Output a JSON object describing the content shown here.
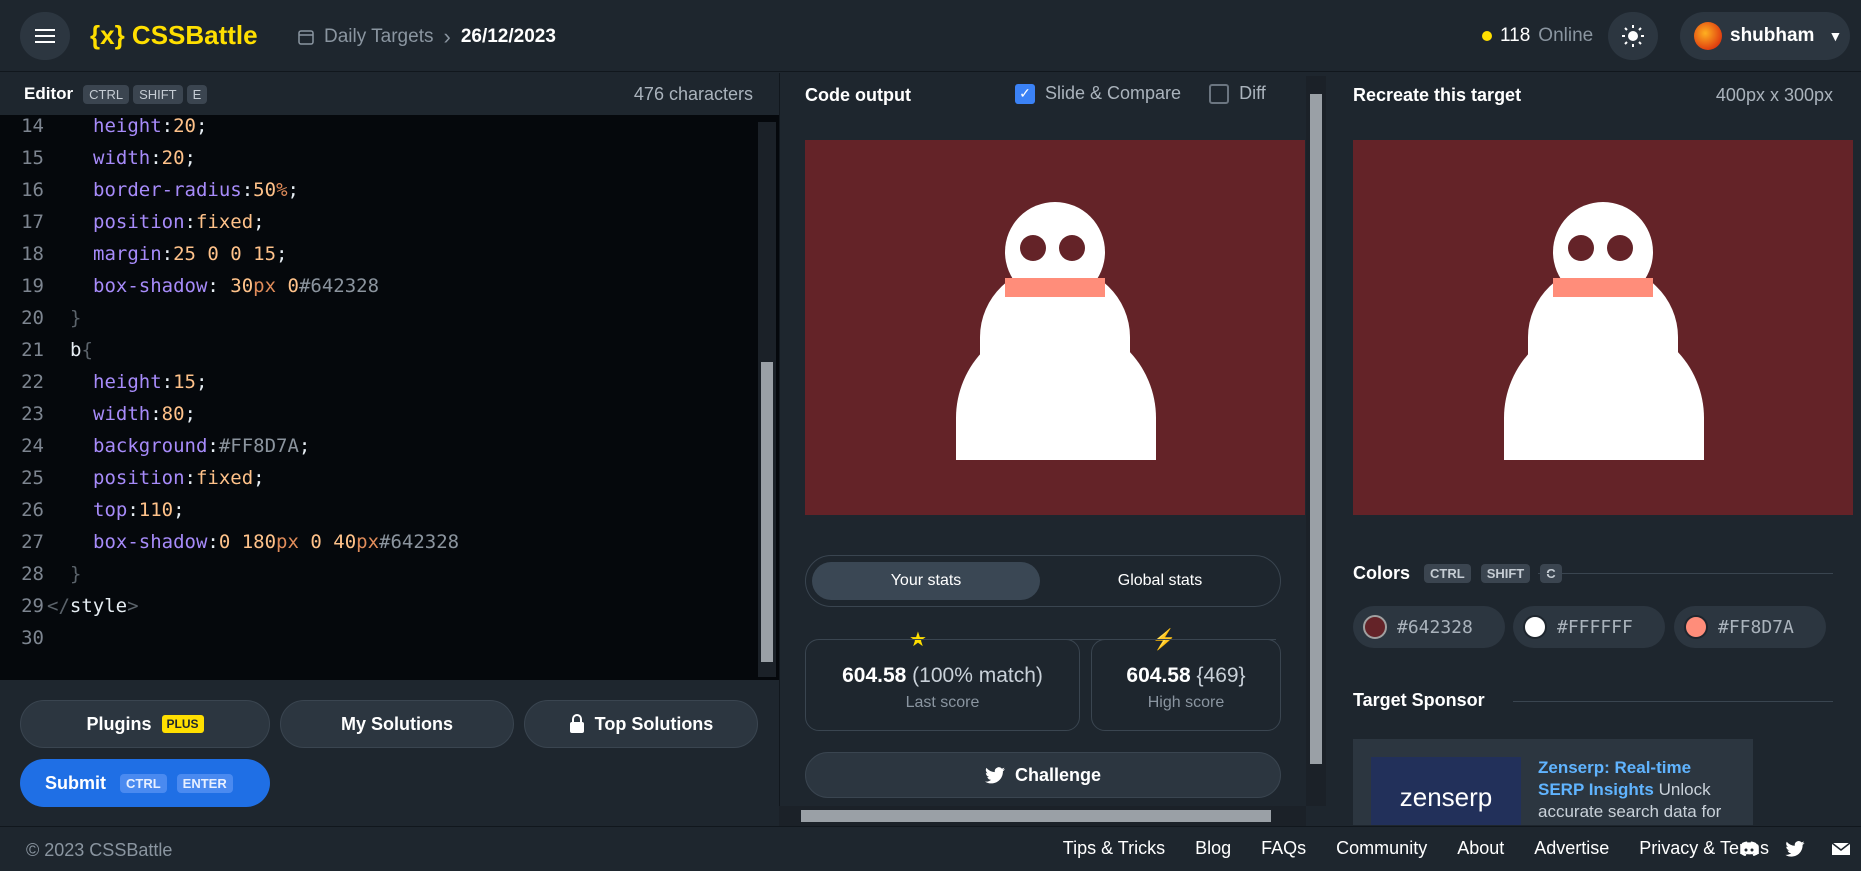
{
  "header": {
    "logo": "{x} CSSBattle",
    "breadcrumb_parent": "Daily Targets",
    "breadcrumb_date": "26/12/2023",
    "online_count": "118",
    "online_label": "Online",
    "username": "shubham"
  },
  "editor": {
    "title": "Editor",
    "shortcut": [
      "CTRL",
      "SHIFT",
      "E"
    ],
    "char_count": "476 characters",
    "lines": [
      {
        "n": "14",
        "parts": [
          [
            "p",
            "height"
          ],
          [
            "w",
            ":"
          ],
          [
            "v",
            "20"
          ],
          [
            "w",
            ";"
          ]
        ],
        "indent": 2
      },
      {
        "n": "15",
        "parts": [
          [
            "p",
            "width"
          ],
          [
            "w",
            ":"
          ],
          [
            "v",
            "20"
          ],
          [
            "w",
            ";"
          ]
        ],
        "indent": 2
      },
      {
        "n": "16",
        "parts": [
          [
            "p",
            "border-radius"
          ],
          [
            "w",
            ":"
          ],
          [
            "v",
            "50"
          ],
          [
            "u",
            "%"
          ],
          [
            "w",
            ";"
          ]
        ],
        "indent": 2
      },
      {
        "n": "17",
        "parts": [
          [
            "p",
            "position"
          ],
          [
            "w",
            ":"
          ],
          [
            "v",
            "fixed"
          ],
          [
            "w",
            ";"
          ]
        ],
        "indent": 2
      },
      {
        "n": "18",
        "parts": [
          [
            "p",
            "margin"
          ],
          [
            "w",
            ":"
          ],
          [
            "v",
            "25 0 0 15"
          ],
          [
            "w",
            ";"
          ]
        ],
        "indent": 2
      },
      {
        "n": "19",
        "parts": [
          [
            "p",
            "box-shadow"
          ],
          [
            "w",
            ": "
          ],
          [
            "v",
            "30"
          ],
          [
            "u",
            "px"
          ],
          [
            "v",
            " 0"
          ],
          [
            "c",
            "#642328"
          ]
        ],
        "indent": 2
      },
      {
        "n": "20",
        "parts": [
          [
            "dim",
            "}"
          ]
        ],
        "indent": 1
      },
      {
        "n": "21",
        "parts": [
          [
            "w",
            "b"
          ],
          [
            "dim",
            "{"
          ]
        ],
        "indent": 1
      },
      {
        "n": "22",
        "parts": [
          [
            "p",
            "height"
          ],
          [
            "w",
            ":"
          ],
          [
            "v",
            "15"
          ],
          [
            "w",
            ";"
          ]
        ],
        "indent": 2
      },
      {
        "n": "23",
        "parts": [
          [
            "p",
            "width"
          ],
          [
            "w",
            ":"
          ],
          [
            "v",
            "80"
          ],
          [
            "w",
            ";"
          ]
        ],
        "indent": 2
      },
      {
        "n": "24",
        "parts": [
          [
            "p",
            "background"
          ],
          [
            "w",
            ":"
          ],
          [
            "c",
            "#FF8D7A"
          ],
          [
            "w",
            ";"
          ]
        ],
        "indent": 2
      },
      {
        "n": "25",
        "parts": [
          [
            "p",
            "position"
          ],
          [
            "w",
            ":"
          ],
          [
            "v",
            "fixed"
          ],
          [
            "w",
            ";"
          ]
        ],
        "indent": 2
      },
      {
        "n": "26",
        "parts": [
          [
            "p",
            "top"
          ],
          [
            "w",
            ":"
          ],
          [
            "v",
            "110"
          ],
          [
            "w",
            ";"
          ]
        ],
        "indent": 2
      },
      {
        "n": "27",
        "parts": [
          [
            "p",
            "box-shadow"
          ],
          [
            "w",
            ":"
          ],
          [
            "v",
            "0 180"
          ],
          [
            "u",
            "px"
          ],
          [
            "v",
            " 0 40"
          ],
          [
            "u",
            "px"
          ],
          [
            "c",
            "#642328"
          ]
        ],
        "indent": 2
      },
      {
        "n": "28",
        "parts": [
          [
            "dim",
            "}"
          ]
        ],
        "indent": 1
      },
      {
        "n": "29",
        "parts": [
          [
            "dim",
            "</"
          ],
          [
            "w",
            "style"
          ],
          [
            "dim",
            ">"
          ]
        ],
        "indent": 0
      },
      {
        "n": "30",
        "parts": [],
        "indent": 0
      }
    ]
  },
  "buttons": {
    "plugins": "Plugins",
    "plugins_badge": "PLUS",
    "my_solutions": "My Solutions",
    "top_solutions": "Top Solutions",
    "submit": "Submit",
    "submit_keys": [
      "CTRL",
      "ENTER"
    ]
  },
  "output": {
    "title": "Code output",
    "slide_compare": "Slide & Compare",
    "slide_checked": true,
    "diff": "Diff",
    "diff_checked": false,
    "tab_your": "Your stats",
    "tab_global": "Global stats",
    "last_score": "604.58",
    "last_match": "(100% match)",
    "last_label": "Last score",
    "high_score": "604.58",
    "high_chars": "{469}",
    "high_label": "High score",
    "challenge": "Challenge"
  },
  "target": {
    "title": "Recreate this target",
    "size": "400px x 300px",
    "colors_label": "Colors",
    "colors_keys": [
      "CTRL",
      "SHIFT",
      "C"
    ],
    "colors": [
      "#642328",
      "#FFFFFF",
      "#FF8D7A"
    ],
    "sponsor_label": "Target Sponsor",
    "sponsor_logo": "zenserp",
    "sponsor_title": "Zenserp: Real-time SERP Insights",
    "sponsor_text": "Unlock accurate search data for"
  },
  "footer": {
    "copyright": "© 2023 CSSBattle",
    "links": [
      "Tips & Tricks",
      "Blog",
      "FAQs",
      "Community",
      "About",
      "Advertise",
      "Privacy & Terms"
    ],
    "icons": [
      "discord-icon",
      "twitter-icon",
      "mail-icon"
    ]
  },
  "accent": "#ffdf00",
  "snowman_colors": {
    "bg": "#642328",
    "body": "#FFFFFF",
    "scarf": "#FF8D7A"
  }
}
